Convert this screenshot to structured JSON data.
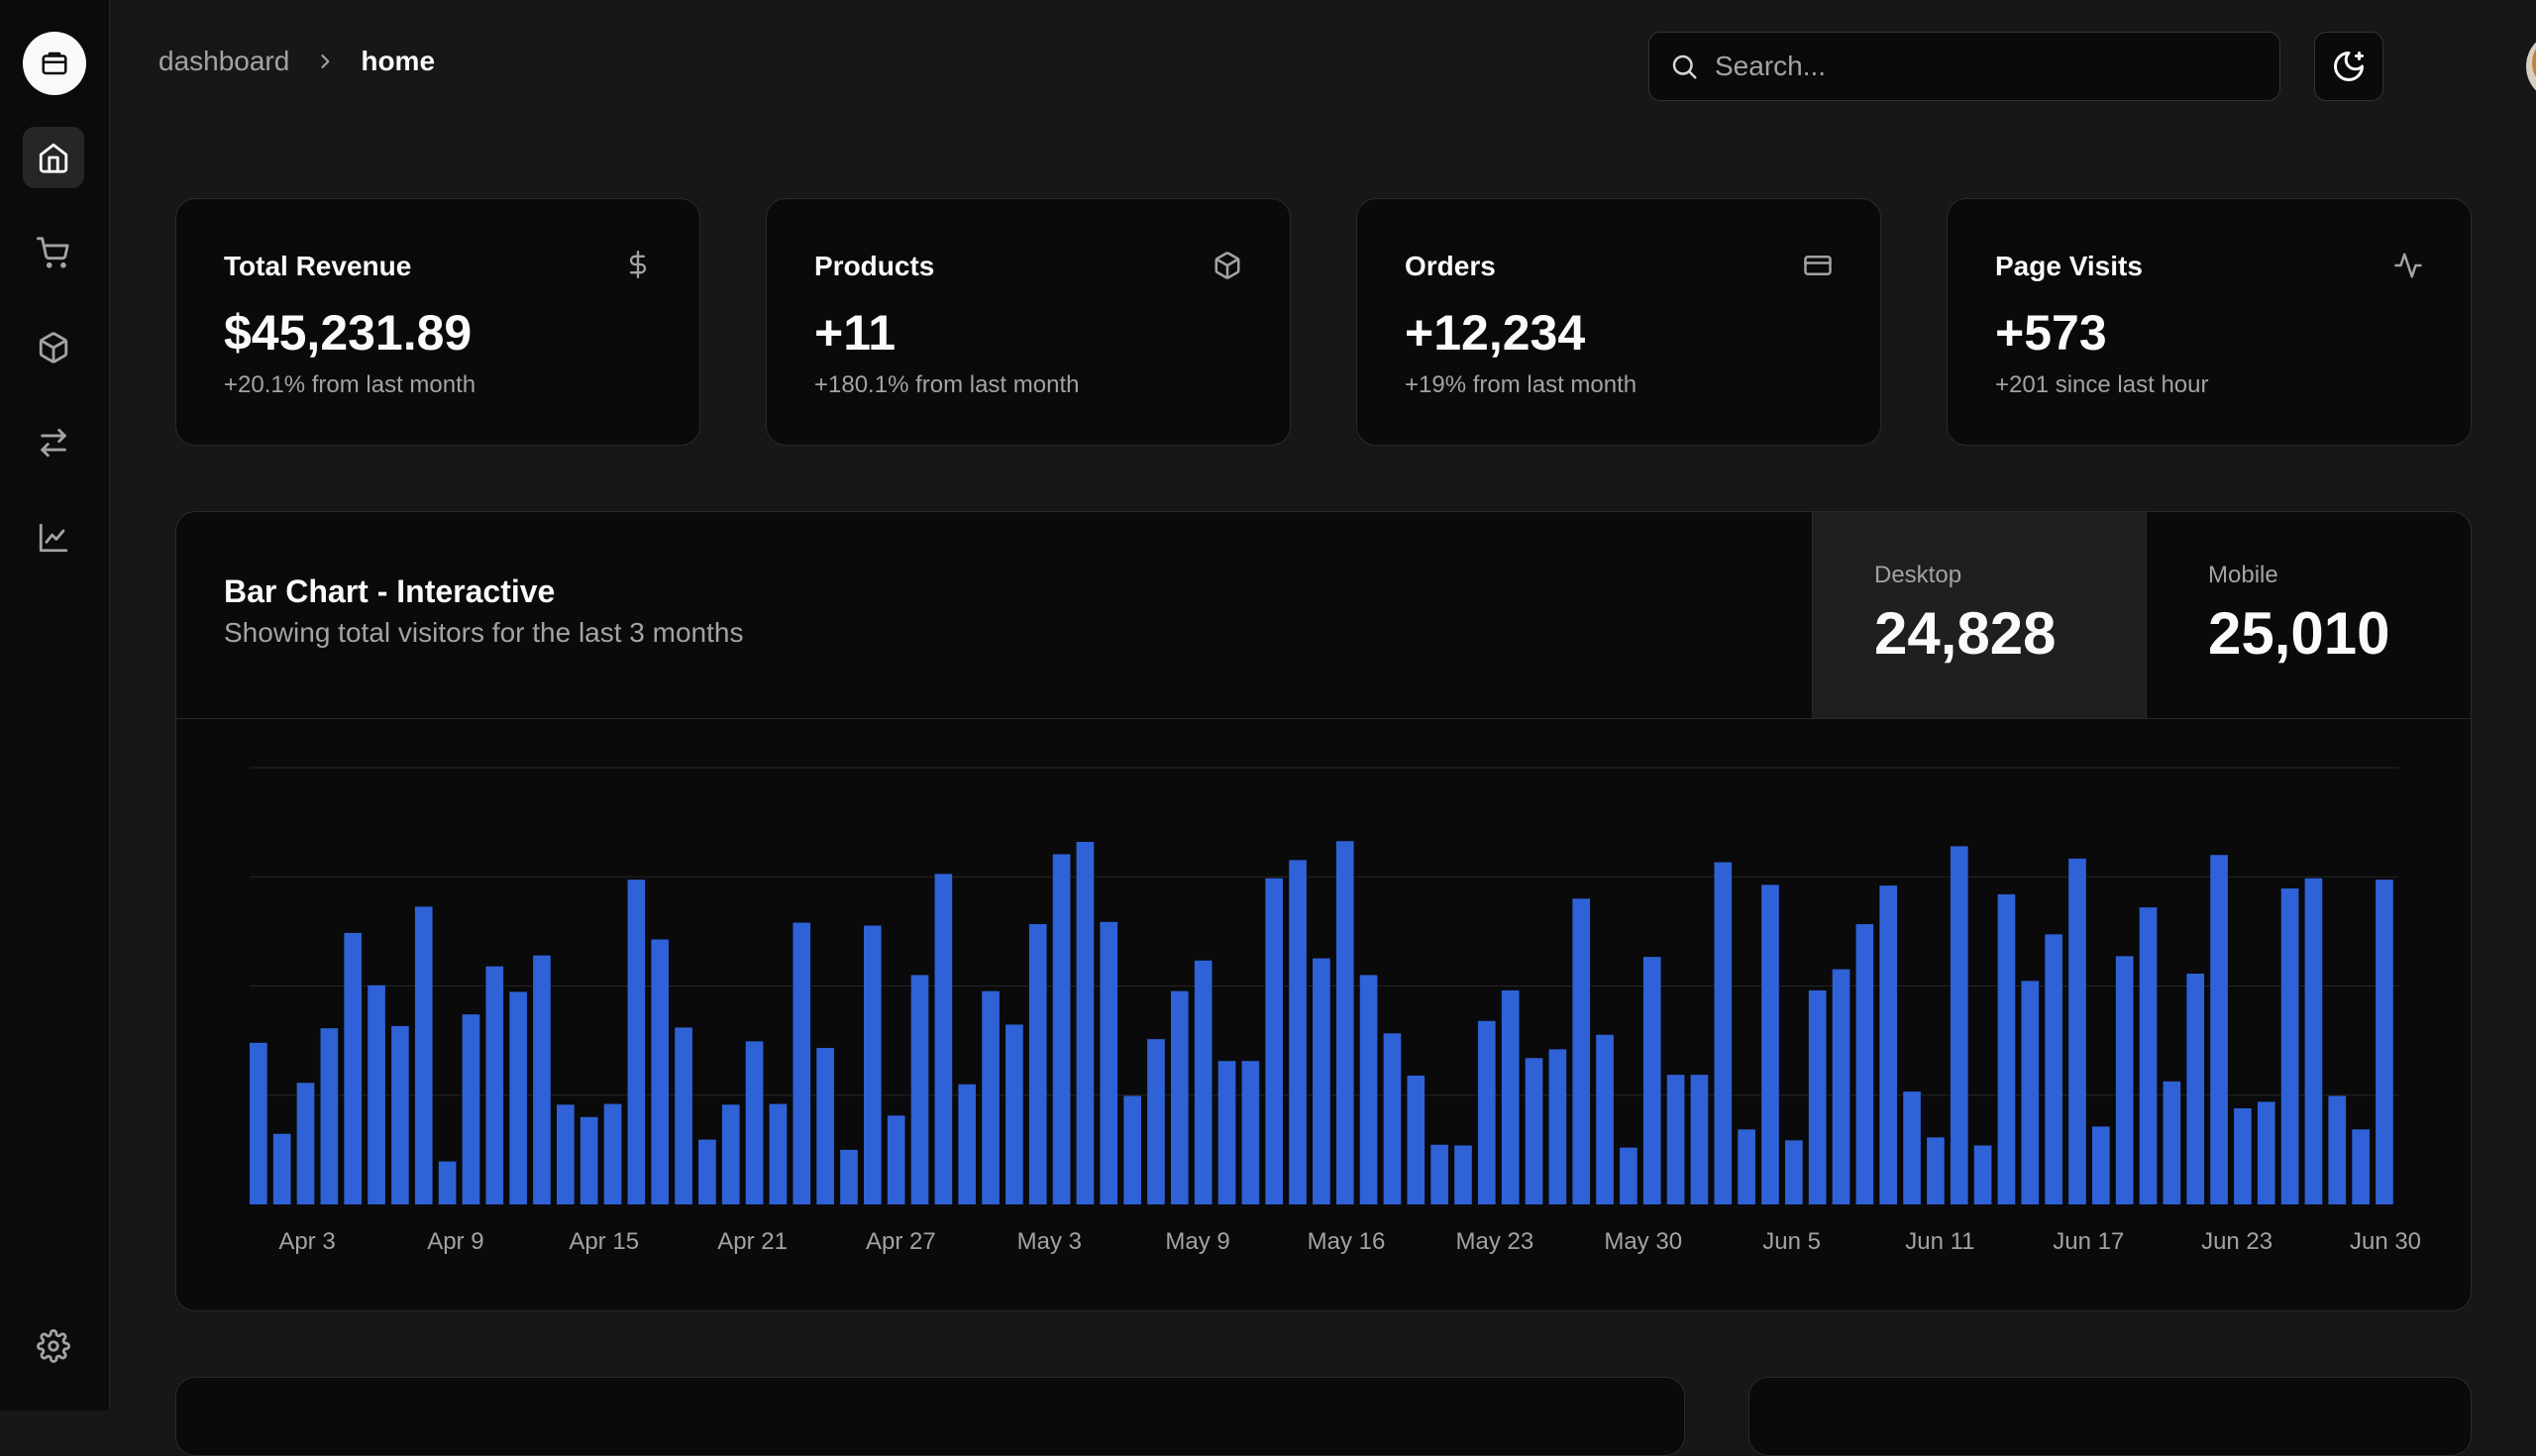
{
  "breadcrumb": {
    "root": "dashboard",
    "current": "home"
  },
  "search": {
    "placeholder": "Search..."
  },
  "stats": [
    {
      "title": "Total Revenue",
      "value": "$45,231.89",
      "sub": "+20.1% from last month",
      "icon": "dollar-icon"
    },
    {
      "title": "Products",
      "value": "+11",
      "sub": "+180.1% from last month",
      "icon": "package-icon"
    },
    {
      "title": "Orders",
      "value": "+12,234",
      "sub": "+19% from last month",
      "icon": "credit-card-icon"
    },
    {
      "title": "Page Visits",
      "value": "+573",
      "sub": "+201 since last hour",
      "icon": "activity-icon"
    }
  ],
  "chart_card": {
    "title": "Bar Chart - Interactive",
    "subtitle": "Showing total visitors for the last 3 months",
    "tabs": [
      {
        "label": "Desktop",
        "value": "24,828",
        "active": true
      },
      {
        "label": "Mobile",
        "value": "25,010",
        "active": false
      }
    ]
  },
  "chart_data": {
    "type": "bar",
    "series": [
      {
        "values": [
          222,
          97,
          167,
          242,
          373,
          301,
          245,
          409,
          59,
          261,
          327,
          292,
          342,
          137,
          120,
          138,
          446,
          364,
          243,
          89,
          137,
          224,
          138,
          387,
          215,
          75,
          383,
          122,
          315,
          454,
          165,
          293,
          247,
          385,
          481,
          498,
          388,
          149,
          227,
          293,
          335,
          197,
          197,
          448,
          473,
          338,
          499,
          315,
          235,
          177,
          82,
          81,
          252,
          294,
          201,
          213,
          420,
          233,
          78,
          340,
          178,
          178,
          470,
          103,
          439,
          88,
          294,
          323,
          385,
          438,
          155,
          92,
          492,
          81,
          426,
          307,
          371,
          475,
          107,
          341,
          408,
          169,
          317,
          480,
          132,
          141,
          434,
          448,
          149,
          103,
          446
        ]
      }
    ],
    "x_tick_labels": [
      "Apr 3",
      "Apr 9",
      "Apr 15",
      "Apr 21",
      "Apr 27",
      "May 3",
      "May 9",
      "May 16",
      "May 23",
      "May 30",
      "Jun 5",
      "Jun 11",
      "Jun 17",
      "Jun 23",
      "Jun 30"
    ],
    "ylim": [
      0,
      600
    ],
    "grid": true,
    "colors": {
      "bar": "#2f62d7",
      "grid": "#262626",
      "tick": "#a3a3a3"
    }
  },
  "colors": {
    "background": "#171717",
    "card": "#0a0a0a",
    "accent": "#2f62d7"
  }
}
